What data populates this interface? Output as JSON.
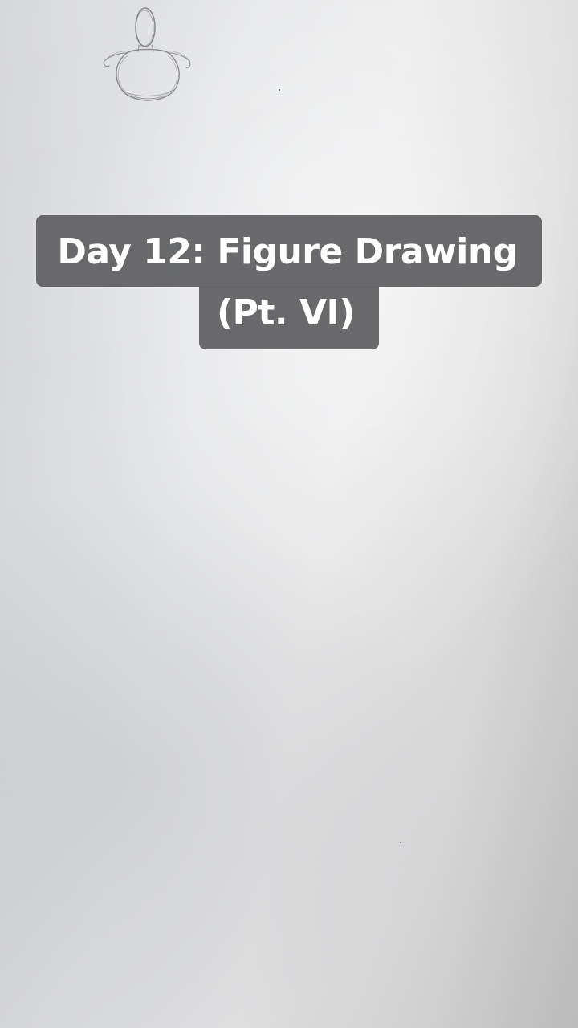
{
  "caption": {
    "line1": "Day 12: Figure Drawing",
    "line2": "(Pt. VI)"
  },
  "colors": {
    "paper": "#e4e5e7",
    "caption_background": "#646466",
    "caption_text": "#ffffff",
    "pencil": "#7a7a7e"
  },
  "icons": {
    "sketch": "pencil-figure-sketch"
  }
}
